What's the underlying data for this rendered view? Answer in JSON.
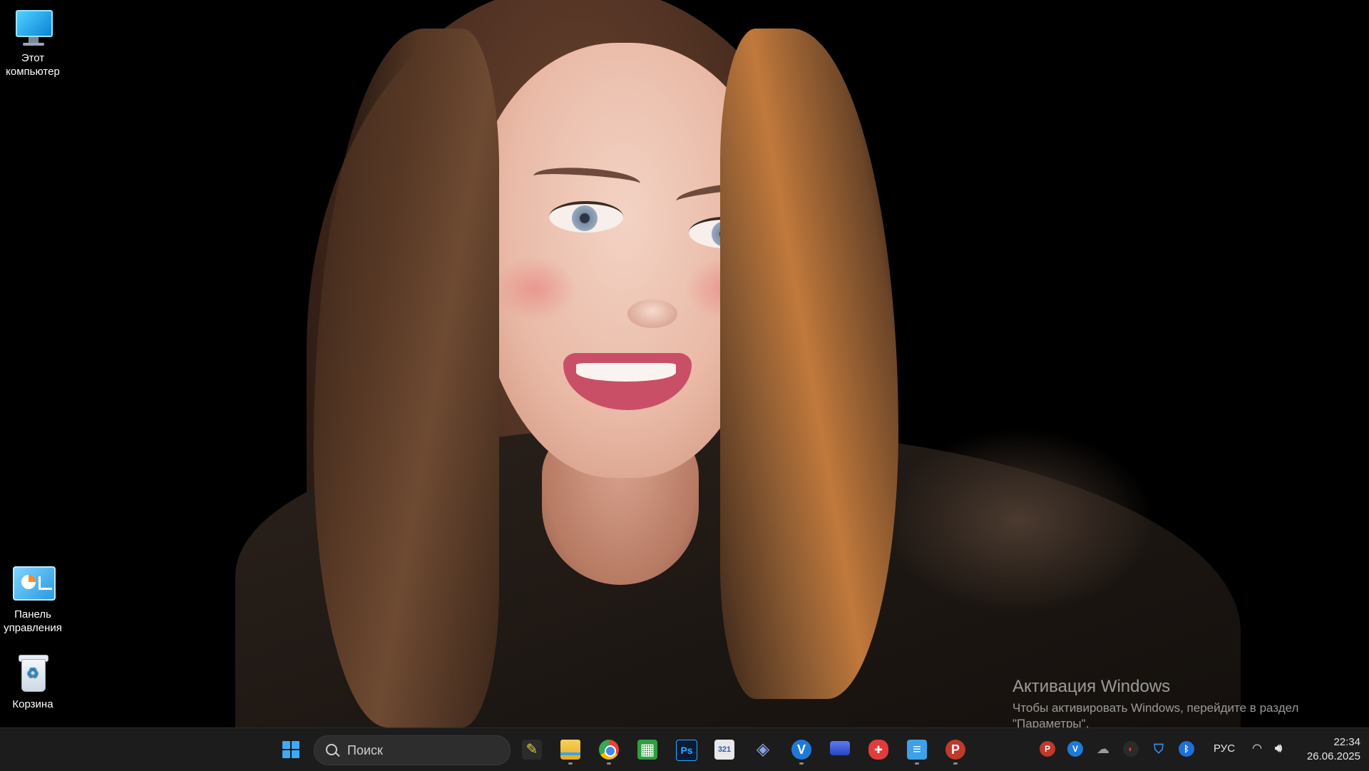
{
  "desktop": {
    "icons": [
      {
        "label": "Этот\nкомпьютер",
        "icon": "computer-icon"
      },
      {
        "label": "Панель\nуправления",
        "icon": "control-panel-icon"
      },
      {
        "label": "Корзина",
        "icon": "recycle-bin-icon"
      }
    ],
    "activation": {
      "title": "Активация Windows",
      "text": "Чтобы активировать Windows, перейдите в раздел \"Параметры\"."
    }
  },
  "taskbar": {
    "search_placeholder": "Поиск",
    "pinned_apps": [
      {
        "name": "ie-pen-app",
        "glyph": "✎",
        "color": "#d8c23a"
      },
      {
        "name": "file-explorer",
        "glyph": "",
        "color": "#f2c232"
      },
      {
        "name": "chrome",
        "glyph": "",
        "color": "#4285f4"
      },
      {
        "name": "spreadsheet",
        "glyph": "▦",
        "color": "#2e9e3e"
      },
      {
        "name": "photoshop",
        "glyph": "Ps",
        "color": "#0b1b33"
      },
      {
        "name": "media-player-classic",
        "glyph": "321",
        "color": "#3a3a3a"
      },
      {
        "name": "layers-app",
        "glyph": "◈",
        "color": "#3a4a8a"
      },
      {
        "name": "vpn-app",
        "glyph": "V",
        "color": "#1f7ad6"
      },
      {
        "name": "remote-desktop",
        "glyph": "▭",
        "color": "#3a58d8"
      },
      {
        "name": "game-controller",
        "glyph": "✚",
        "color": "#e23b3b"
      },
      {
        "name": "notepad",
        "glyph": "≡",
        "color": "#3ea0e6"
      },
      {
        "name": "psiphon",
        "glyph": "P",
        "color": "#c0392b"
      }
    ],
    "tray": {
      "language": "РУС",
      "time": "22:34",
      "date": "26.06.2025"
    }
  }
}
